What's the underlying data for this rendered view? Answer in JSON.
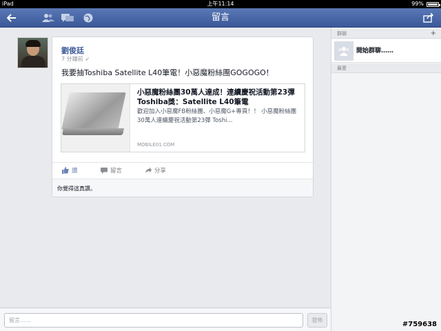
{
  "status_bar": {
    "device": "iPad",
    "time": "上午11:14",
    "battery": "99%"
  },
  "nav": {
    "title": "留言"
  },
  "post": {
    "author": "劉俊廷",
    "time": "7 分鐘前",
    "text": "我要抽Toshiba Satellite L40筆電！小惡魔粉絲團GOGOGO！",
    "link": {
      "title": "小惡魔粉絲團30萬人達成！連續慶祝活動第23彈 Toshiba獎：Satellite L40筆電",
      "description": "歡迎加入小惡魔FB粉絲團、小惡魔G+專頁！！ 小惡魔粉絲團30萬人連續慶祝活動第23彈 Toshi...",
      "domain": "MOBILE01.COM"
    },
    "actions": {
      "like": "讚",
      "comment": "留言",
      "share": "分享"
    },
    "likes_text": "你覺得這真讚。"
  },
  "sidebar": {
    "groups_header": "群聊",
    "groups_add": "+",
    "start_group": "開始群聊……",
    "favorites_header": "最愛"
  },
  "composer": {
    "placeholder": "留言……",
    "submit": "發佈"
  },
  "watermark": "#759638",
  "colors": {
    "brand_blue": "#3b5998",
    "background": "#e9eaed"
  },
  "icons": {
    "back": "back-arrow-icon",
    "friends": "friend-requests-icon",
    "messages": "messages-icon",
    "notifications": "notifications-globe-icon",
    "share": "share-icon",
    "like": "thumbs-up-icon",
    "comment": "comment-bubble-icon",
    "share_action": "share-arrow-icon",
    "group": "group-icon"
  }
}
